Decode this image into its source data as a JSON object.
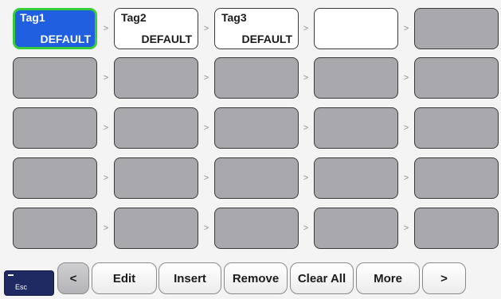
{
  "tags": [
    {
      "name": "Tag1",
      "value": "DEFAULT",
      "state": "selected"
    },
    {
      "name": "Tag2",
      "value": "DEFAULT",
      "state": "white"
    },
    {
      "name": "Tag3",
      "value": "DEFAULT",
      "state": "white"
    },
    {
      "name": "",
      "value": "",
      "state": "white"
    },
    {
      "name": "",
      "value": "",
      "state": "empty"
    }
  ],
  "arrow_glyph": ">",
  "toolbar": {
    "esc": "Esc",
    "prev": "<",
    "edit": "Edit",
    "insert": "Insert",
    "remove": "Remove",
    "clear_all": "Clear All",
    "more": "More",
    "next": ">"
  }
}
